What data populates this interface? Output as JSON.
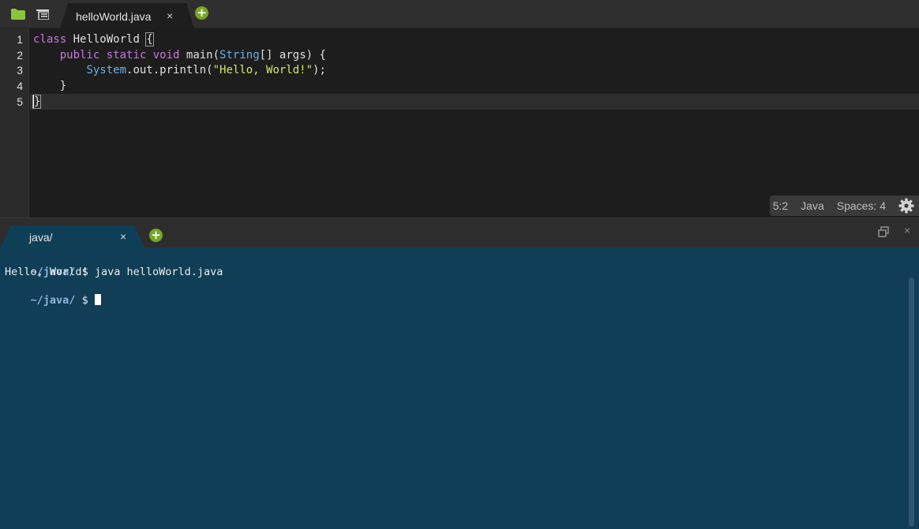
{
  "editor_tabbar": {
    "icons": [
      "folder-icon",
      "outline-icon"
    ],
    "tab": {
      "label": "helloWorld.java",
      "close": "×"
    },
    "add": "+"
  },
  "editor": {
    "line_numbers": [
      "1",
      "2",
      "3",
      "4",
      "5"
    ],
    "lines": [
      "class HelloWorld {",
      "    public static void main(String[] args) {",
      "        System.out.println(\"Hello, World!\");",
      "    }",
      "}"
    ],
    "active_line": 5
  },
  "status": {
    "position": "5:2",
    "language": "Java",
    "indent": "Spaces: 4",
    "settings_icon": "gear-icon"
  },
  "terminal_tabbar": {
    "tab": {
      "label": "java/",
      "close": "×"
    },
    "add": "+",
    "restore_icon": "restore-icon",
    "close": "×"
  },
  "terminal": {
    "lines": [
      {
        "prompt": "~/java/",
        "symbol": "$",
        "command": "java helloWorld.java"
      },
      {
        "output": "Hello, World!"
      },
      {
        "prompt": "~/java/",
        "symbol": "$",
        "command": ""
      }
    ]
  },
  "colors": {
    "keyword": "#c678dd",
    "type": "#69b0e6",
    "string": "#d2e66b",
    "terminal_bg": "#0f3e56",
    "accent_green": "#77a626"
  }
}
